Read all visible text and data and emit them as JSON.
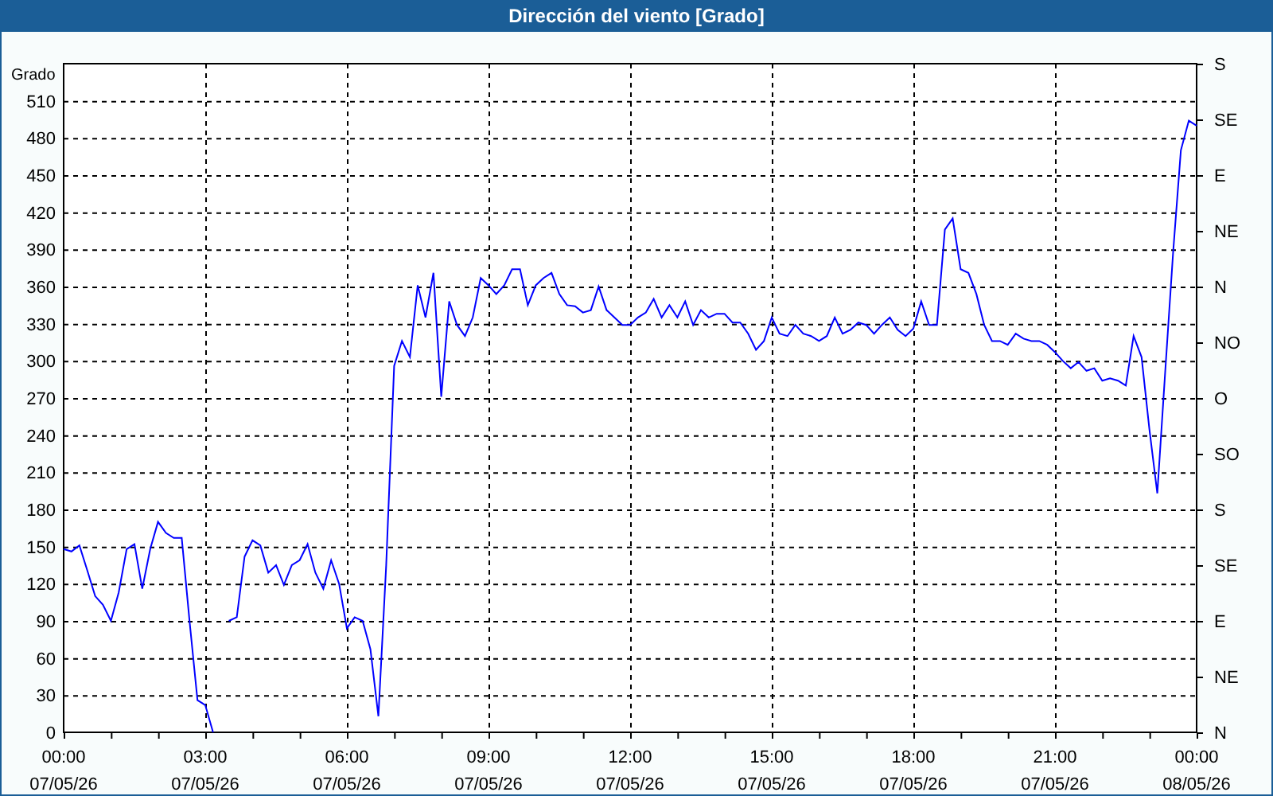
{
  "window": {
    "title": "Dirección del viento [Grado]"
  },
  "chart": {
    "secondary_axis": {
      "labels": [
        "S",
        "SE",
        "E",
        "NE",
        "N",
        "NO",
        "O",
        "SO",
        "S",
        "SE",
        "E",
        "NE",
        "N"
      ]
    },
    "chart_data": {
      "type": "line",
      "ylabel": "Grado",
      "grid": true,
      "ylim": [
        0,
        540
      ],
      "categories": [
        "00:00 07/05/26",
        null,
        null,
        null,
        null,
        null,
        null,
        null,
        null,
        null,
        null,
        null,
        null,
        null,
        null,
        null,
        null,
        null,
        "03:00 07/05/26",
        null,
        null,
        null,
        null,
        null,
        null,
        null,
        null,
        null,
        null,
        null,
        null,
        null,
        null,
        null,
        null,
        null,
        "06:00 07/05/26",
        null,
        null,
        null,
        null,
        null,
        null,
        null,
        null,
        null,
        null,
        null,
        null,
        null,
        null,
        null,
        null,
        null,
        "09:00 07/05/26",
        null,
        null,
        null,
        null,
        null,
        null,
        null,
        null,
        null,
        null,
        null,
        null,
        null,
        null,
        null,
        null,
        null,
        "12:00 07/05/26",
        null,
        null,
        null,
        null,
        null,
        null,
        null,
        null,
        null,
        null,
        null,
        null,
        null,
        null,
        null,
        null,
        null,
        "15:00 07/05/26",
        null,
        null,
        null,
        null,
        null,
        null,
        null,
        null,
        null,
        null,
        null,
        null,
        null,
        null,
        null,
        null,
        null,
        "18:00 07/05/26",
        null,
        null,
        null,
        null,
        null,
        null,
        null,
        null,
        null,
        null,
        null,
        null,
        null,
        null,
        null,
        null,
        null,
        "21:00 07/05/26",
        null,
        null,
        null,
        null,
        null,
        null,
        null,
        null,
        null,
        null,
        null,
        null,
        null,
        null,
        null,
        null,
        null,
        "00:00 08/05/26"
      ],
      "yticks": [
        0,
        30,
        60,
        90,
        120,
        150,
        180,
        210,
        240,
        270,
        300,
        330,
        360,
        390,
        420,
        450,
        480,
        510
      ],
      "series": [
        {
          "color": "#0000ff",
          "values": [
            148,
            146,
            151,
            131,
            110,
            103,
            90,
            113,
            148,
            152,
            116,
            148,
            170,
            161,
            157,
            157,
            90,
            26,
            22,
            0,
            null,
            90,
            93,
            142,
            155,
            151,
            129,
            135,
            119,
            135,
            139,
            152,
            129,
            116,
            139,
            120,
            84,
            93,
            90,
            67,
            13,
            135,
            296,
            316,
            303,
            361,
            335,
            371,
            271,
            348,
            329,
            320,
            335,
            367,
            361,
            354,
            361,
            374,
            374,
            345,
            361,
            367,
            371,
            354,
            345,
            344,
            339,
            341,
            360,
            341,
            335,
            329,
            329,
            335,
            339,
            350,
            335,
            345,
            335,
            348,
            329,
            341,
            335,
            338,
            338,
            331,
            331,
            322,
            309,
            316,
            335,
            322,
            320,
            329,
            322,
            320,
            316,
            320,
            335,
            322,
            325,
            331,
            329,
            322,
            329,
            335,
            325,
            320,
            326,
            348,
            329,
            329,
            406,
            415,
            374,
            371,
            354,
            329,
            316,
            316,
            313,
            322,
            318,
            316,
            316,
            313,
            307,
            300,
            294,
            299,
            292,
            294,
            284,
            286,
            284,
            280,
            320,
            303,
            245,
            193,
            290,
            387,
            470,
            494,
            490
          ]
        }
      ]
    }
  }
}
